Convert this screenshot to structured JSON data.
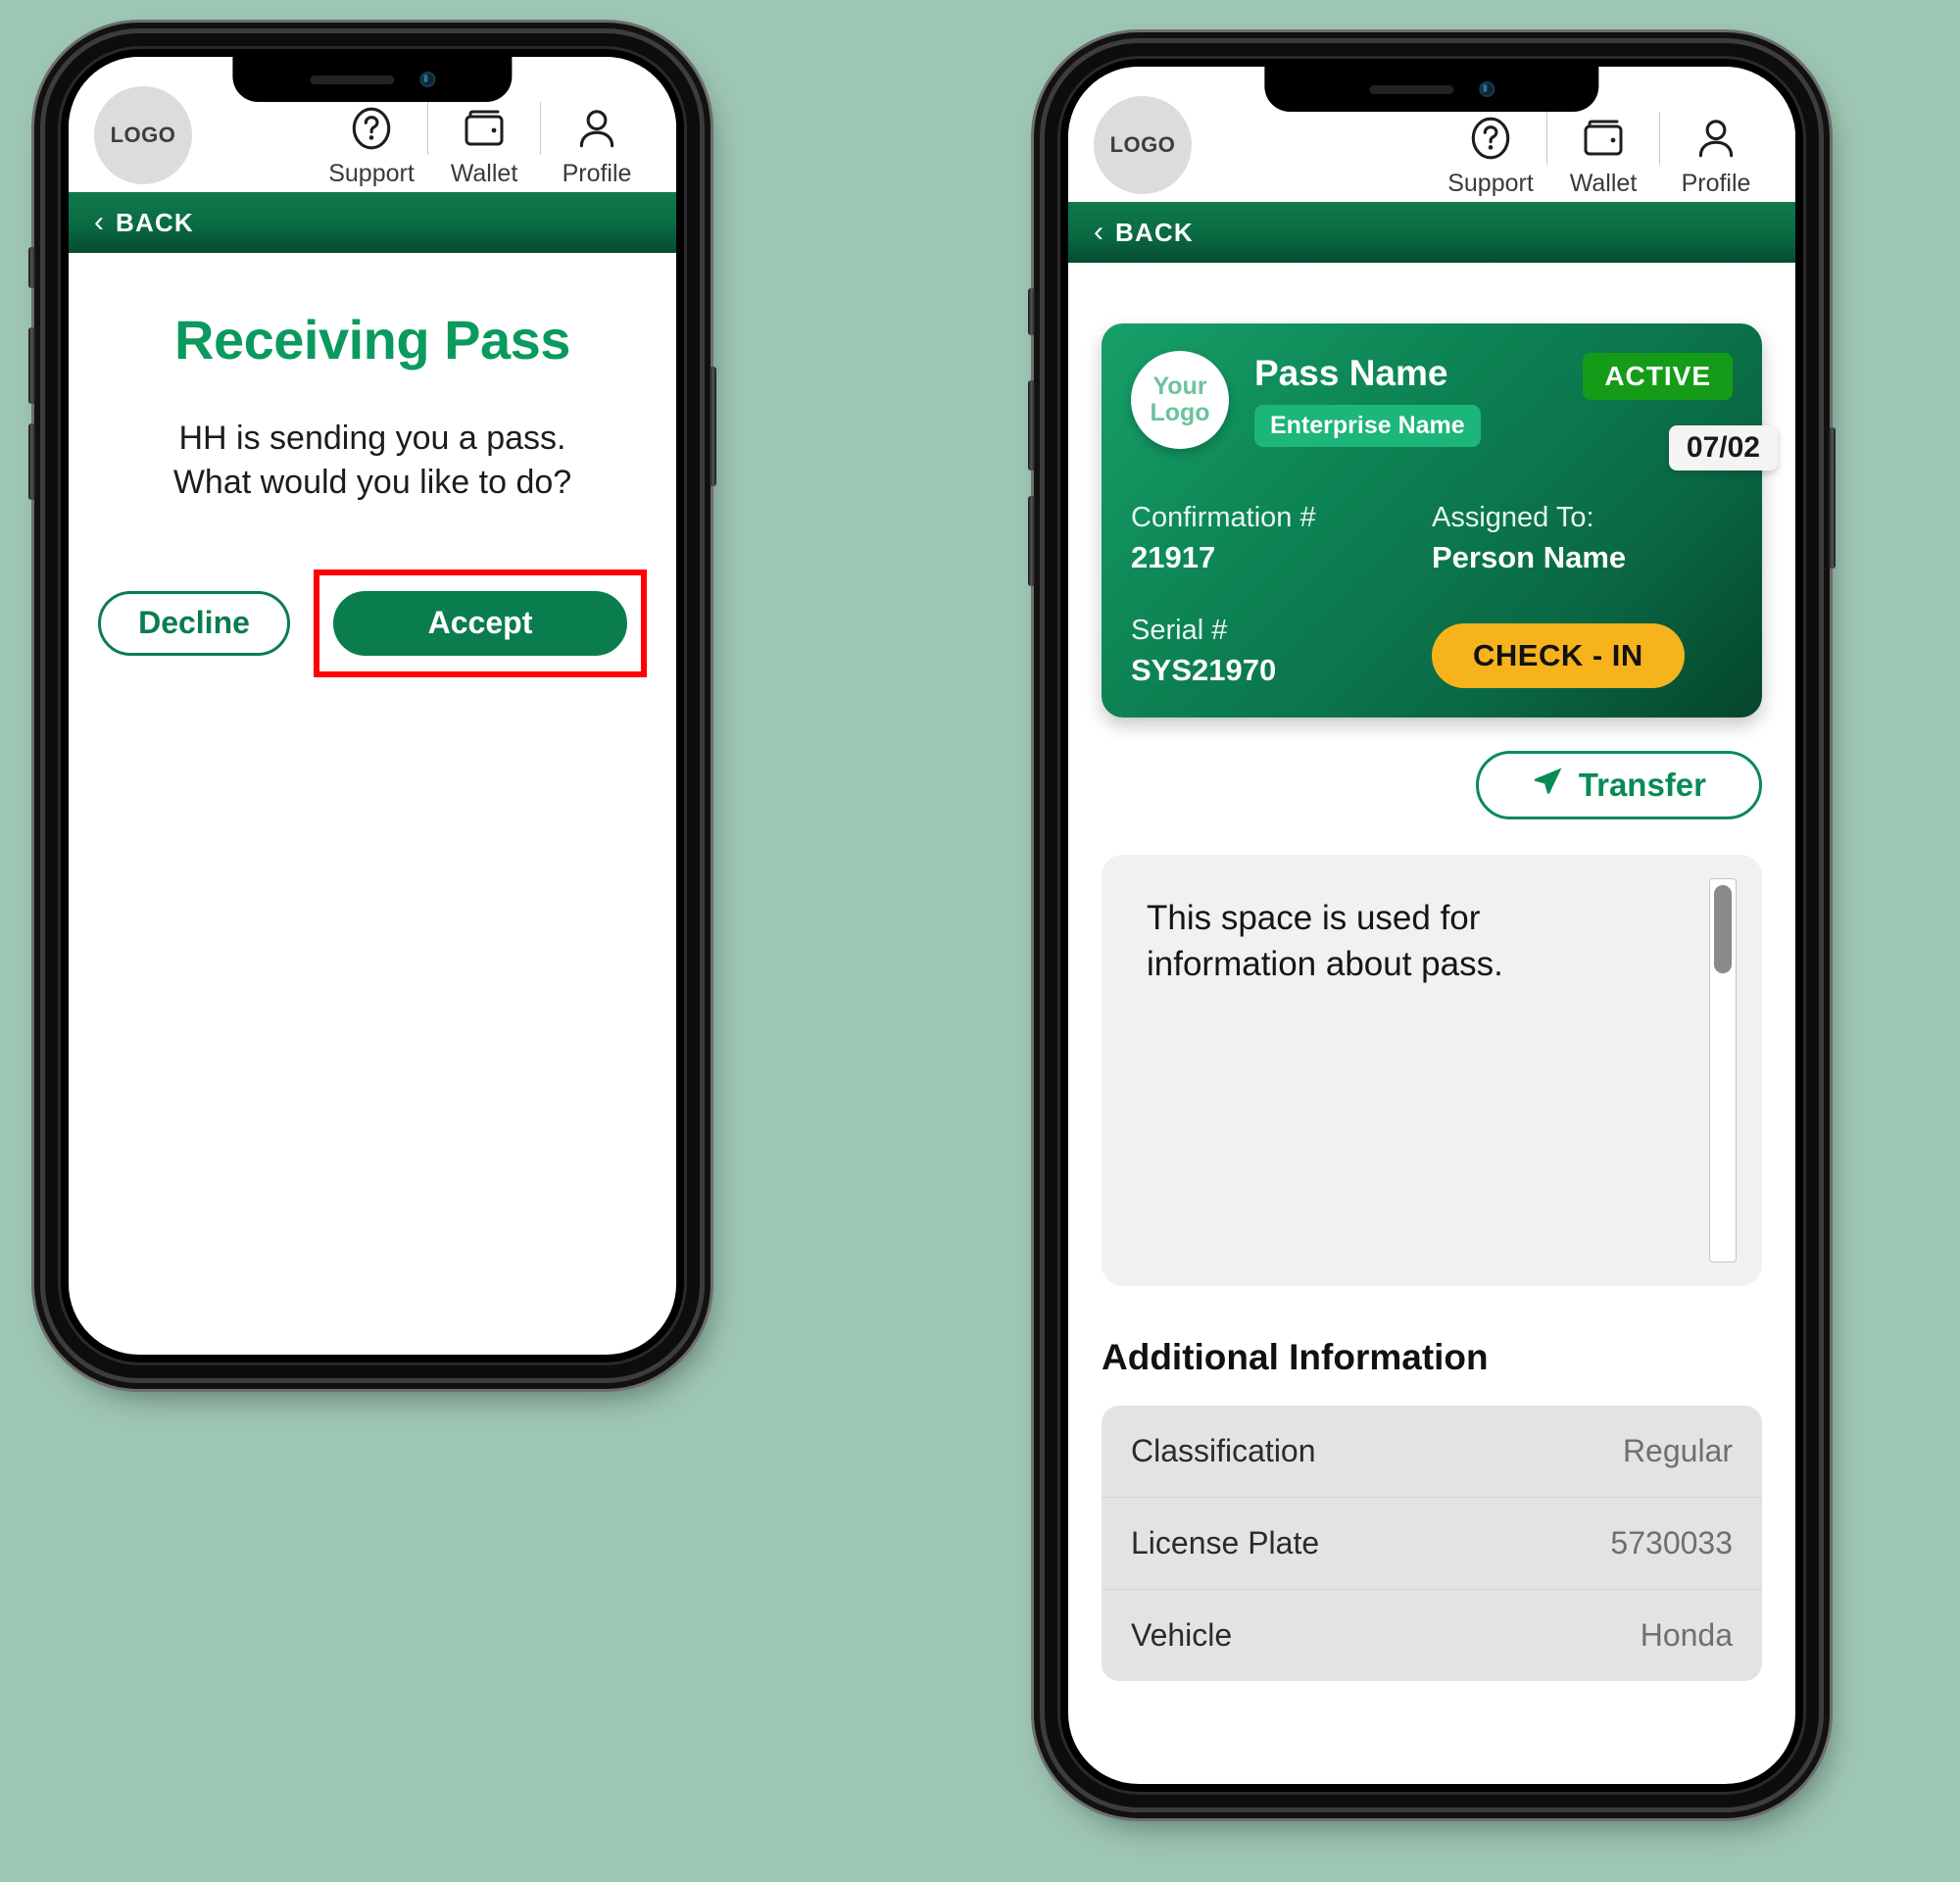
{
  "app": {
    "logo_text": "LOGO",
    "header_actions": [
      {
        "label": "Support",
        "icon": "question-circle-icon"
      },
      {
        "label": "Wallet",
        "icon": "wallet-icon"
      },
      {
        "label": "Profile",
        "icon": "person-icon"
      }
    ],
    "back_label": "BACK"
  },
  "colors": {
    "brand_green": "#0a7d4e",
    "title_green": "#0b9a5e",
    "bar_green": "#0a6a42",
    "active_badge": "#149c18",
    "checkin_yellow": "#f6b31c",
    "highlight_red": "#ff0000",
    "page_background": "#9ec7b3"
  },
  "screen1": {
    "title": "Receiving Pass",
    "subtitle_line1": "HH is sending you a pass.",
    "subtitle_line2": "What would you like to do?",
    "decline_label": "Decline",
    "accept_label": "Accept"
  },
  "screen2": {
    "card": {
      "your_logo_line1": "Your",
      "your_logo_line2": "Logo",
      "pass_name": "Pass Name",
      "enterprise_name": "Enterprise Name",
      "status": "ACTIVE",
      "date": "07/02",
      "confirmation_label": "Confirmation #",
      "confirmation_value": "21917",
      "assigned_label": "Assigned To:",
      "assigned_value": "Person Name",
      "serial_label": "Serial #",
      "serial_value": "SYS21970",
      "checkin_label": "CHECK - IN"
    },
    "transfer_label": "Transfer",
    "info_text": "This space is used for information about pass.",
    "additional_title": "Additional Information",
    "additional_rows": [
      {
        "key": "Classification",
        "value": "Regular"
      },
      {
        "key": "License Plate",
        "value": "5730033"
      },
      {
        "key": "Vehicle",
        "value": "Honda"
      }
    ]
  }
}
